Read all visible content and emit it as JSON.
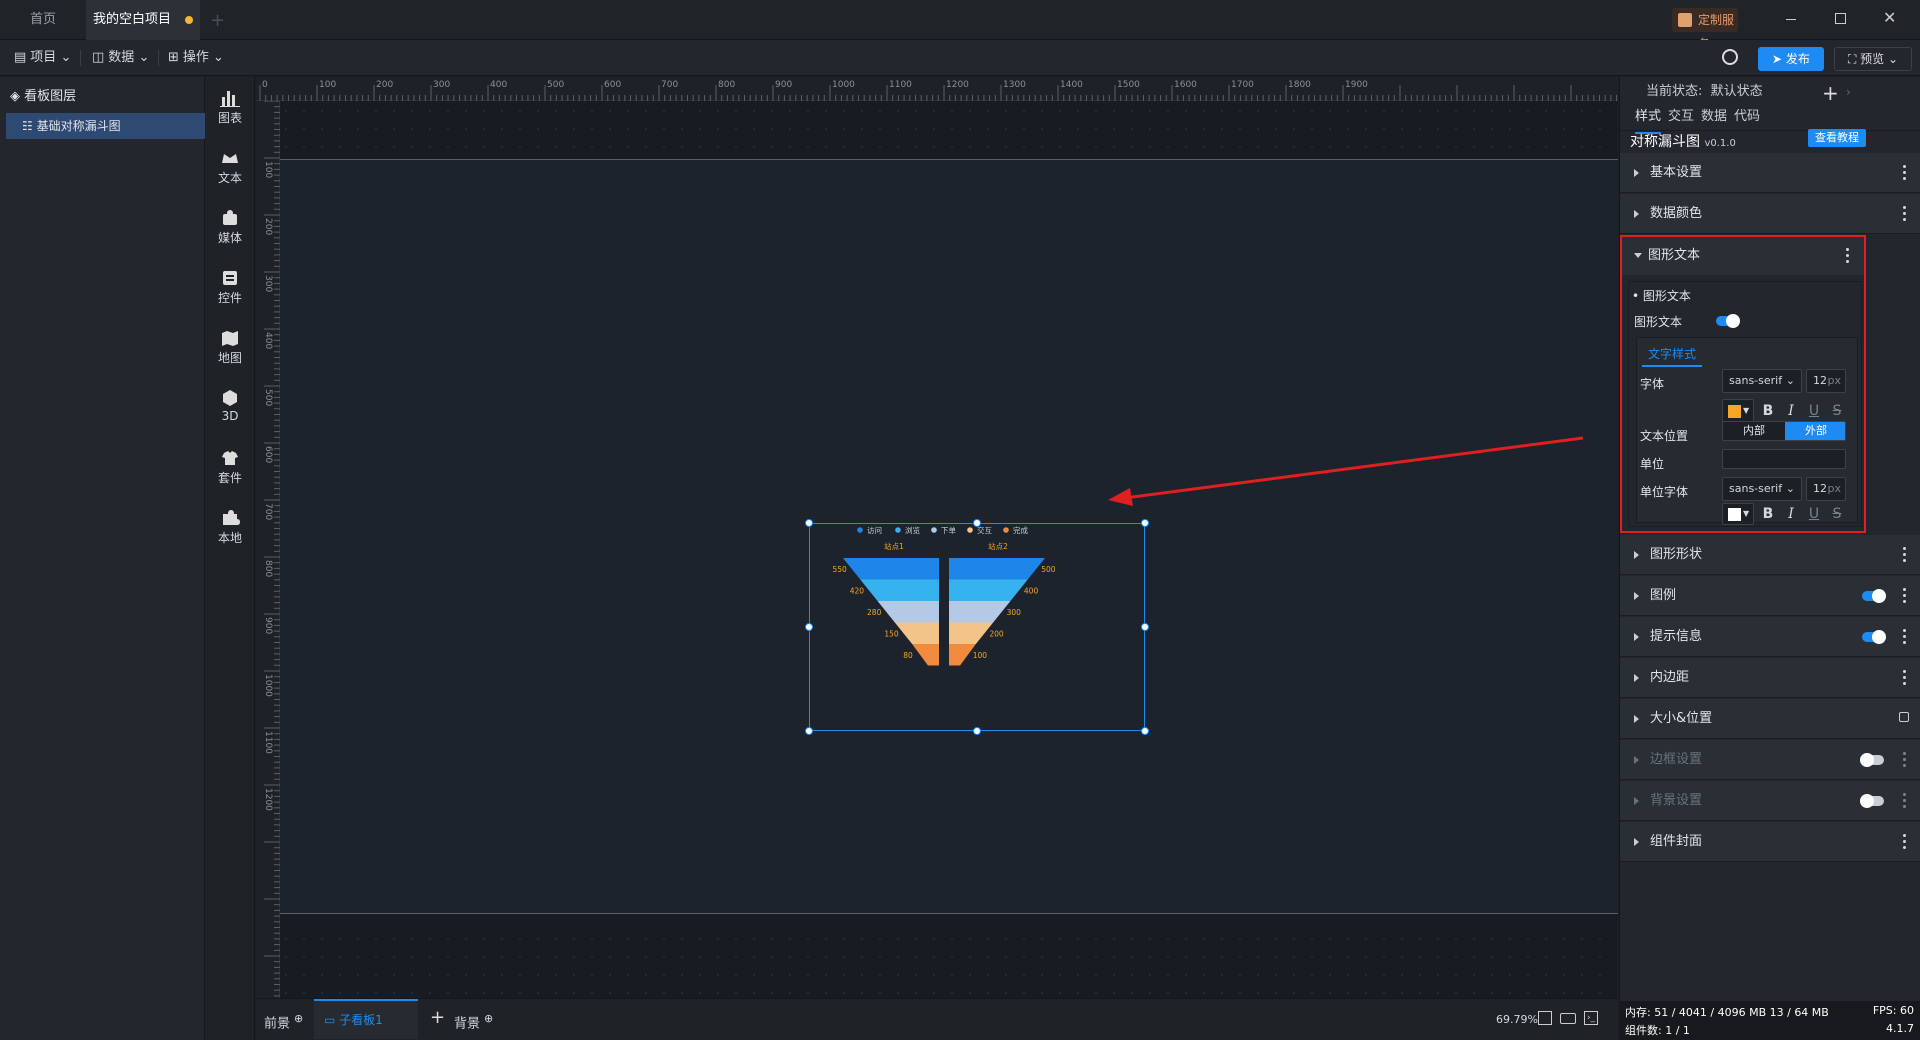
{
  "tabs": {
    "home": "首页",
    "project": "我的空白项目"
  },
  "titlebar": {
    "custom_service": "定制服务"
  },
  "menu": {
    "project": "项目",
    "data": "数据",
    "operation": "操作",
    "publish": "发布",
    "preview": "预览"
  },
  "layers": {
    "title": "看板图层",
    "items": [
      {
        "label": "基础对称漏斗图"
      }
    ]
  },
  "tools": [
    {
      "label": "图表",
      "icon": "chart-icon"
    },
    {
      "label": "文本",
      "icon": "text-icon"
    },
    {
      "label": "媒体",
      "icon": "media-icon"
    },
    {
      "label": "控件",
      "icon": "widget-icon"
    },
    {
      "label": "地图",
      "icon": "map-icon"
    },
    {
      "label": "3D",
      "icon": "cube-icon"
    },
    {
      "label": "套件",
      "icon": "suite-icon"
    },
    {
      "label": "本地",
      "icon": "puzzle-icon"
    }
  ],
  "ruler": {
    "top": [
      "0",
      "100",
      "200",
      "300",
      "400",
      "500",
      "600",
      "700",
      "800",
      "900",
      "1000",
      "1100",
      "1200",
      "1300",
      "1400",
      "1500",
      "1600",
      "1700",
      "1800",
      "1900"
    ],
    "left": [
      "100",
      "200",
      "300",
      "400",
      "500",
      "600",
      "700",
      "800",
      "900",
      "1000",
      "1100",
      "1200"
    ]
  },
  "chart_data": {
    "type": "funnel",
    "legend": [
      "访问",
      "浏览",
      "下单",
      "交互",
      "完成"
    ],
    "legend_colors": [
      "#1d86e8",
      "#36b3ef",
      "#b4c9e6",
      "#f2c48a",
      "#f08a3c"
    ],
    "series": [
      {
        "name": "站点1",
        "values": [
          550,
          420,
          280,
          150,
          80
        ]
      },
      {
        "name": "站点2",
        "values": [
          500,
          400,
          300,
          200,
          100
        ]
      }
    ],
    "label_color": "#f5a623"
  },
  "bottom": {
    "foreground": "前景",
    "sub_board": "子看板1",
    "background": "背景",
    "zoom": "69.79%"
  },
  "right": {
    "state_label": "当前状态:",
    "state_value": "默认状态",
    "tabs": [
      "样式",
      "交互",
      "数据",
      "代码"
    ],
    "component_name": "对称漏斗图",
    "version": "v0.1.0",
    "tutorial": "查看教程",
    "sections_top": [
      "基本设置",
      "数据颜色"
    ],
    "graphic_text": {
      "title": "图形文本",
      "sub_title": "图形文本",
      "toggle_label": "图形文本",
      "toggle_on": true,
      "text_style_tab": "文字样式",
      "font_label": "字体",
      "font_value": "sans-serif",
      "font_size": "12",
      "unit_px": "px",
      "font_color": "#f5a623",
      "position_label": "文本位置",
      "position_inner": "内部",
      "position_outer": "外部",
      "unit_label": "单位",
      "unit_value": "",
      "unit_font_label": "单位字体",
      "unit_font_value": "sans-serif",
      "unit_font_size": "12",
      "unit_font_color": "#ffffff",
      "bold": "B",
      "italic": "I",
      "underline": "U",
      "strike": "S"
    },
    "sections_bottom": [
      {
        "label": "图形形状",
        "toggle": null,
        "disabled": false
      },
      {
        "label": "图例",
        "toggle": true,
        "disabled": false
      },
      {
        "label": "提示信息",
        "toggle": true,
        "disabled": false
      },
      {
        "label": "内边距",
        "toggle": null,
        "disabled": false
      },
      {
        "label": "大小&位置",
        "toggle": null,
        "disabled": false,
        "lock": true
      },
      {
        "label": "边框设置",
        "toggle": false,
        "disabled": true
      },
      {
        "label": "背景设置",
        "toggle": false,
        "disabled": true
      },
      {
        "label": "组件封面",
        "toggle": null,
        "disabled": false
      }
    ]
  },
  "status": {
    "memory": "内存:  51 / 4041 / 4096 MB  13 / 64 MB",
    "fps": "FPS:  60",
    "components": "组件数: 1 / 1",
    "version": "4.1.7"
  }
}
